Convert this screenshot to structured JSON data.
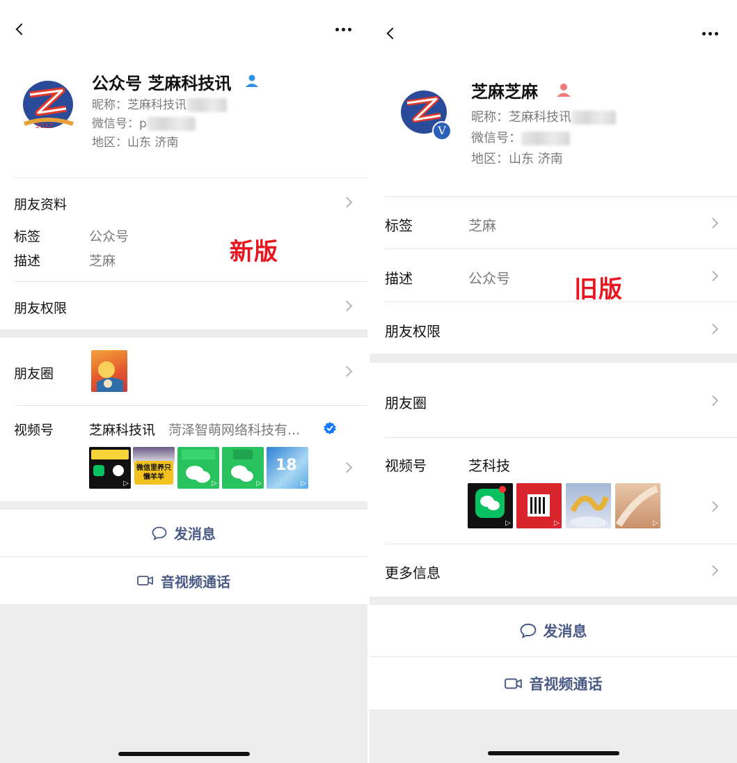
{
  "new_version": {
    "stamp": "新版",
    "name": "公众号 芝麻科技讯",
    "nickname": "昵称：芝麻科技讯",
    "wechat_id": "微信号：p",
    "region": "地区：山东 济南",
    "friend_profile": "朋友资料",
    "tag_label": "标签",
    "tag_value": "公众号",
    "desc_label": "描述",
    "desc_value": "芝麻",
    "permissions": "朋友权限",
    "moments": "朋友圈",
    "channels_label": "视频号",
    "channels_name": "芝麻科技讯",
    "channels_org": "菏泽智萌网络科技有...",
    "thumbs": [
      {
        "caption": "微信里养只懒羊羊"
      },
      {
        "caption": "18"
      }
    ],
    "send_message": "发消息",
    "av_call": "音视频通话"
  },
  "old_version": {
    "stamp": "旧版",
    "name": "芝麻芝麻",
    "nickname": "昵称：芝麻科技讯",
    "wechat_id": "微信号：",
    "region": "地区：山东 济南",
    "tag_label": "标签",
    "tag_value": "芝麻",
    "desc_label": "描述",
    "desc_value": "公众号",
    "permissions": "朋友权限",
    "moments": "朋友圈",
    "channels_label": "视频号",
    "channels_name": "芝科技",
    "more_info": "更多信息",
    "send_message": "发消息",
    "av_call": "音视频通话",
    "verified_badge": "V"
  },
  "colors": {
    "accent_link": "#4a5a86",
    "stamp_red": "#e8161f",
    "verified_blue": "#1677ff",
    "page_gray": "#ededed"
  },
  "icons": [
    "back-icon",
    "more-icon",
    "person-icon",
    "chevron-right-icon",
    "chat-bubble-icon",
    "video-camera-icon",
    "verified-icon",
    "play-icon"
  ]
}
